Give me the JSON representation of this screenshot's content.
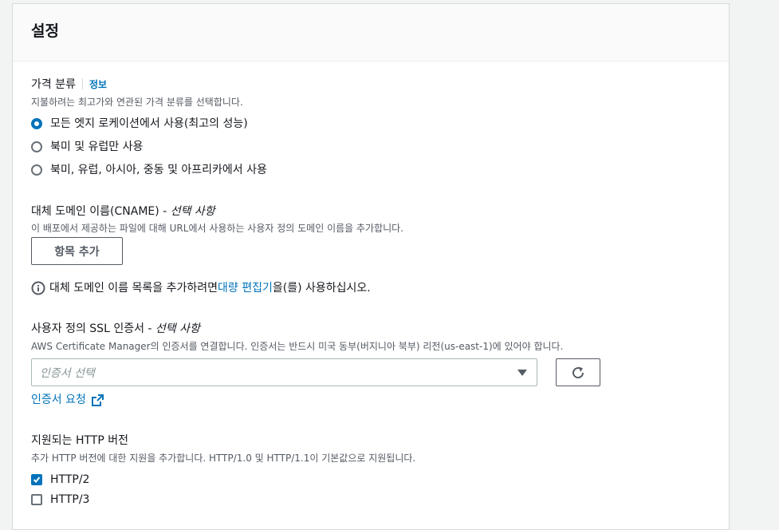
{
  "panel": {
    "title": "설정"
  },
  "price_class": {
    "label": "가격 분류",
    "info": "정보",
    "description": "지불하려는 최고가와 연관된 가격 분류를 선택합니다.",
    "options": [
      {
        "label": "모든 엣지 로케이션에서 사용(최고의 성능)",
        "selected": true
      },
      {
        "label": "북미 및 유럽만 사용",
        "selected": false
      },
      {
        "label": "북미, 유럽, 아시아, 중동 및 아프리카에서 사용",
        "selected": false
      }
    ]
  },
  "cname": {
    "label": "대체 도메인 이름(CNAME) - ",
    "optional": "선택 사항",
    "description": "이 배포에서 제공하는 파일에 대해 URL에서 사용하는 사용자 정의 도메인 이름을 추가합니다.",
    "add_button": "항목 추가",
    "note_prefix": "대체 도메인 이름 목록을 추가하려면 ",
    "note_link": "대량 편집기",
    "note_suffix": "을(를) 사용하십시오."
  },
  "ssl": {
    "label": "사용자 정의 SSL 인증서 - ",
    "optional": "선택 사항",
    "description": "AWS Certificate Manager의 인증서를 연결합니다. 인증서는 반드시 미국 동부(버지니아 북부) 리전(us-east-1)에 있어야 합니다.",
    "select_placeholder": "인증서 선택",
    "request_link": "인증서 요청"
  },
  "http": {
    "label": "지원되는 HTTP 버전",
    "description": "추가 HTTP 버전에 대한 지원을 추가합니다. HTTP/1.0 및 HTTP/1.1이 기본값으로 지원됩니다.",
    "options": [
      {
        "label": "HTTP/2",
        "checked": true
      },
      {
        "label": "HTTP/3",
        "checked": false
      }
    ]
  },
  "colors": {
    "accent": "#0073bb",
    "text": "#16191f",
    "secondary_text": "#545b64"
  },
  "icons": [
    "info-icon",
    "refresh-icon",
    "external-link-icon",
    "caret-down-icon",
    "check-icon"
  ]
}
